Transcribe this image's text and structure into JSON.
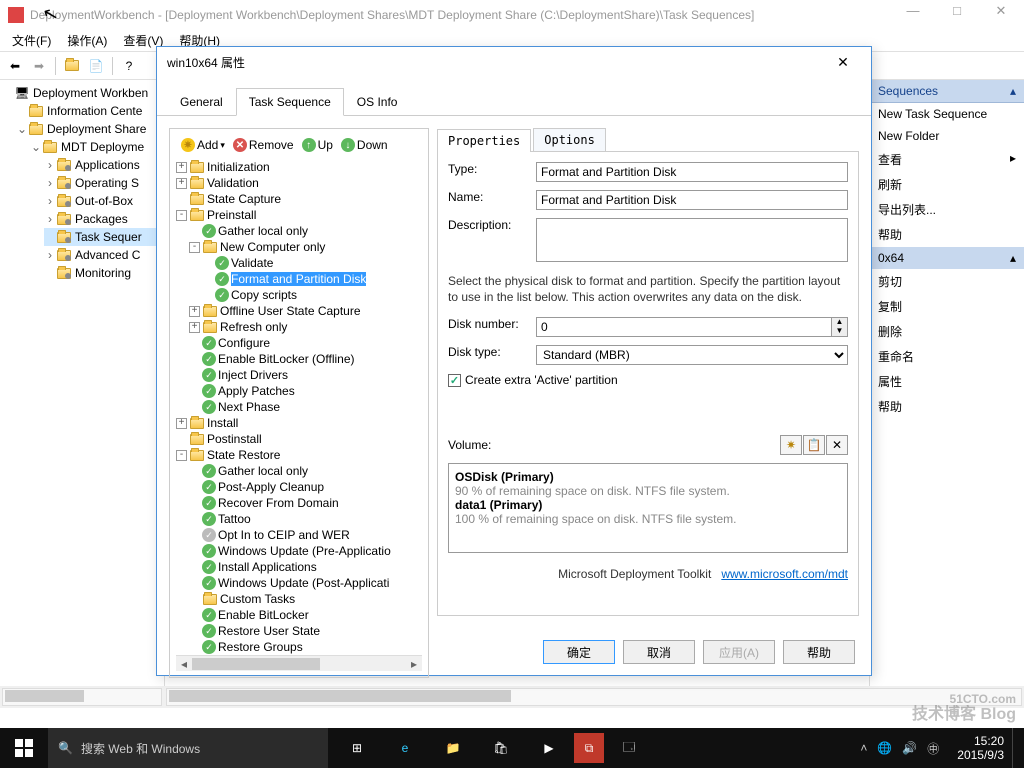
{
  "window": {
    "title": "DeploymentWorkbench - [Deployment Workbench\\Deployment Shares\\MDT Deployment Share (C:\\DeploymentShare)\\Task Sequences]",
    "menus": {
      "file": "文件(F)",
      "action": "操作(A)",
      "view": "查看(V)",
      "help": "帮助(H)"
    }
  },
  "left_tree": {
    "root": "Deployment Workben",
    "nodes": [
      "Information Cente",
      "Deployment Share",
      "MDT Deployme",
      "Applications",
      "Operating S",
      "Out-of-Box",
      "Packages",
      "Task Sequer",
      "Advanced C",
      "Monitoring"
    ]
  },
  "right_panel": {
    "header": "Sequences",
    "items": [
      "New Task Sequence",
      "New Folder",
      "查看",
      "刷新",
      "导出列表...",
      "帮助"
    ],
    "selected_header": "0x64",
    "sel_items": [
      "剪切",
      "复制",
      "删除",
      "重命名",
      "属性",
      "帮助"
    ]
  },
  "dialog": {
    "title": "win10x64 属性",
    "tabs": {
      "general": "General",
      "task_sequence": "Task Sequence",
      "os_info": "OS Info"
    },
    "ts_toolbar": {
      "add": "Add",
      "remove": "Remove",
      "up": "Up",
      "down": "Down"
    },
    "ts_tree": [
      {
        "lvl": 0,
        "exp": "+",
        "type": "folder",
        "label": "Initialization"
      },
      {
        "lvl": 0,
        "exp": "+",
        "type": "folder",
        "label": "Validation"
      },
      {
        "lvl": 0,
        "exp": "",
        "type": "folder",
        "label": "State Capture"
      },
      {
        "lvl": 0,
        "exp": "-",
        "type": "folder",
        "label": "Preinstall"
      },
      {
        "lvl": 1,
        "exp": "",
        "type": "check",
        "label": "Gather local only"
      },
      {
        "lvl": 1,
        "exp": "-",
        "type": "folder",
        "label": "New Computer only"
      },
      {
        "lvl": 2,
        "exp": "",
        "type": "check",
        "label": "Validate"
      },
      {
        "lvl": 2,
        "exp": "",
        "type": "check",
        "label": "Format and Partition Disk",
        "sel": true
      },
      {
        "lvl": 2,
        "exp": "",
        "type": "check",
        "label": "Copy scripts"
      },
      {
        "lvl": 1,
        "exp": "+",
        "type": "folder",
        "label": "Offline User State Capture"
      },
      {
        "lvl": 1,
        "exp": "+",
        "type": "folder",
        "label": "Refresh only"
      },
      {
        "lvl": 1,
        "exp": "",
        "type": "check",
        "label": "Configure"
      },
      {
        "lvl": 1,
        "exp": "",
        "type": "check",
        "label": "Enable BitLocker (Offline)"
      },
      {
        "lvl": 1,
        "exp": "",
        "type": "check",
        "label": "Inject Drivers"
      },
      {
        "lvl": 1,
        "exp": "",
        "type": "check",
        "label": "Apply Patches"
      },
      {
        "lvl": 1,
        "exp": "",
        "type": "check",
        "label": "Next Phase"
      },
      {
        "lvl": 0,
        "exp": "+",
        "type": "folder",
        "label": "Install"
      },
      {
        "lvl": 0,
        "exp": "",
        "type": "folder",
        "label": "Postinstall"
      },
      {
        "lvl": 0,
        "exp": "-",
        "type": "folder",
        "label": "State Restore"
      },
      {
        "lvl": 1,
        "exp": "",
        "type": "check",
        "label": "Gather local only"
      },
      {
        "lvl": 1,
        "exp": "",
        "type": "check",
        "label": "Post-Apply Cleanup"
      },
      {
        "lvl": 1,
        "exp": "",
        "type": "check",
        "label": "Recover From Domain"
      },
      {
        "lvl": 1,
        "exp": "",
        "type": "check",
        "label": "Tattoo"
      },
      {
        "lvl": 1,
        "exp": "",
        "type": "grey",
        "label": "Opt In to CEIP and WER"
      },
      {
        "lvl": 1,
        "exp": "",
        "type": "check",
        "label": "Windows Update (Pre-Applicatio"
      },
      {
        "lvl": 1,
        "exp": "",
        "type": "check",
        "label": "Install Applications"
      },
      {
        "lvl": 1,
        "exp": "",
        "type": "check",
        "label": "Windows Update (Post-Applicati"
      },
      {
        "lvl": 1,
        "exp": "",
        "type": "folder",
        "label": "Custom Tasks"
      },
      {
        "lvl": 1,
        "exp": "",
        "type": "check",
        "label": "Enable BitLocker"
      },
      {
        "lvl": 1,
        "exp": "",
        "type": "check",
        "label": "Restore User State"
      },
      {
        "lvl": 1,
        "exp": "",
        "type": "check",
        "label": "Restore Groups"
      }
    ],
    "prop_tabs": {
      "properties": "Properties",
      "options": "Options"
    },
    "props": {
      "type_label": "Type:",
      "type_value": "Format and Partition Disk",
      "name_label": "Name:",
      "name_value": "Format and Partition Disk",
      "desc_label": "Description:",
      "desc_value": "",
      "info_text": "Select the physical disk to format and partition.  Specify the partition layout to use in the list below. This action overwrites any data on the disk.",
      "disk_num_label": "Disk number:",
      "disk_num_value": "0",
      "disk_type_label": "Disk type:",
      "disk_type_value": "Standard (MBR)",
      "create_active": "Create extra 'Active' partition",
      "volume_label": "Volume:",
      "volumes": [
        {
          "name": "OSDisk (Primary)",
          "desc": "90 % of remaining space on disk. NTFS file system."
        },
        {
          "name": "data1 (Primary)",
          "desc": "100 % of remaining space on disk. NTFS file system."
        }
      ],
      "footer_brand": "Microsoft Deployment Toolkit",
      "footer_link": "www.microsoft.com/mdt"
    },
    "buttons": {
      "ok": "确定",
      "cancel": "取消",
      "apply": "应用(A)",
      "help": "帮助"
    }
  },
  "taskbar": {
    "search_placeholder": "搜索 Web 和 Windows",
    "time": "15:20",
    "date": "2015/9/3"
  },
  "watermark": {
    "l1": "51CTO.com",
    "l2": "技术博客  Blog"
  }
}
